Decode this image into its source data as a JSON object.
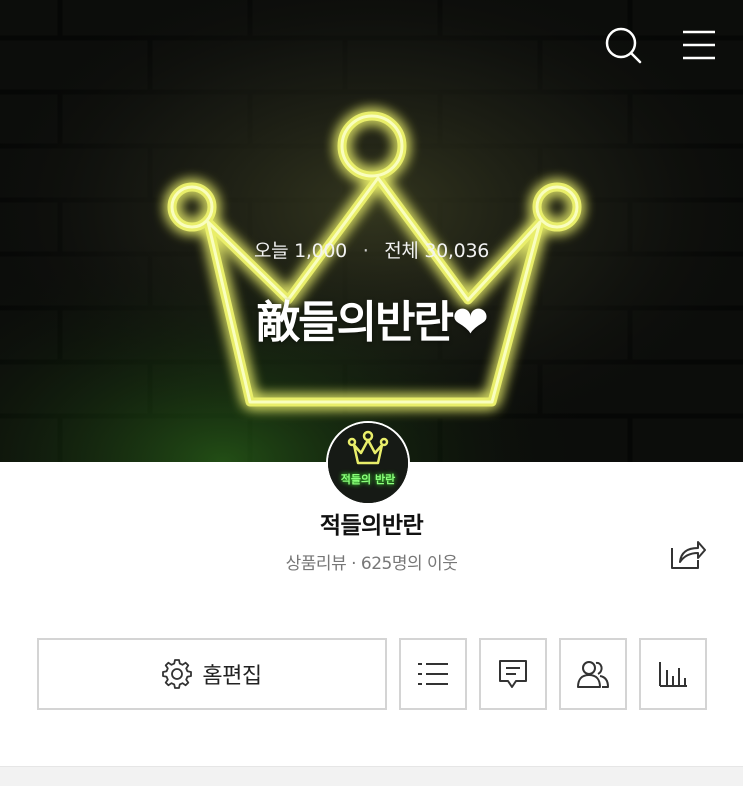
{
  "cover": {
    "visits": {
      "today_label": "오늘",
      "today_count": "1,000",
      "separator": "·",
      "total_label": "전체",
      "total_count": "30,036"
    },
    "title": "敵들의반란❤"
  },
  "header": {
    "search_icon": "search-icon",
    "menu_icon": "hamburger-menu-icon"
  },
  "profile": {
    "avatar_text": "적들의 반란",
    "nickname": "적들의반란",
    "subinfo": "상품리뷰 · 625명의 이웃",
    "share_icon": "share-icon"
  },
  "actions": {
    "edit_label": "홈편집",
    "edit_icon": "gear-icon",
    "list_icon": "list-icon",
    "comment_icon": "comment-icon",
    "neighbor_icon": "neighbors-icon",
    "stats_icon": "stats-icon"
  },
  "colors": {
    "neon_yellow": "#e8ff4a",
    "neon_green": "#63ff4a",
    "border": "#d4d4d4",
    "subtext": "#777777"
  }
}
